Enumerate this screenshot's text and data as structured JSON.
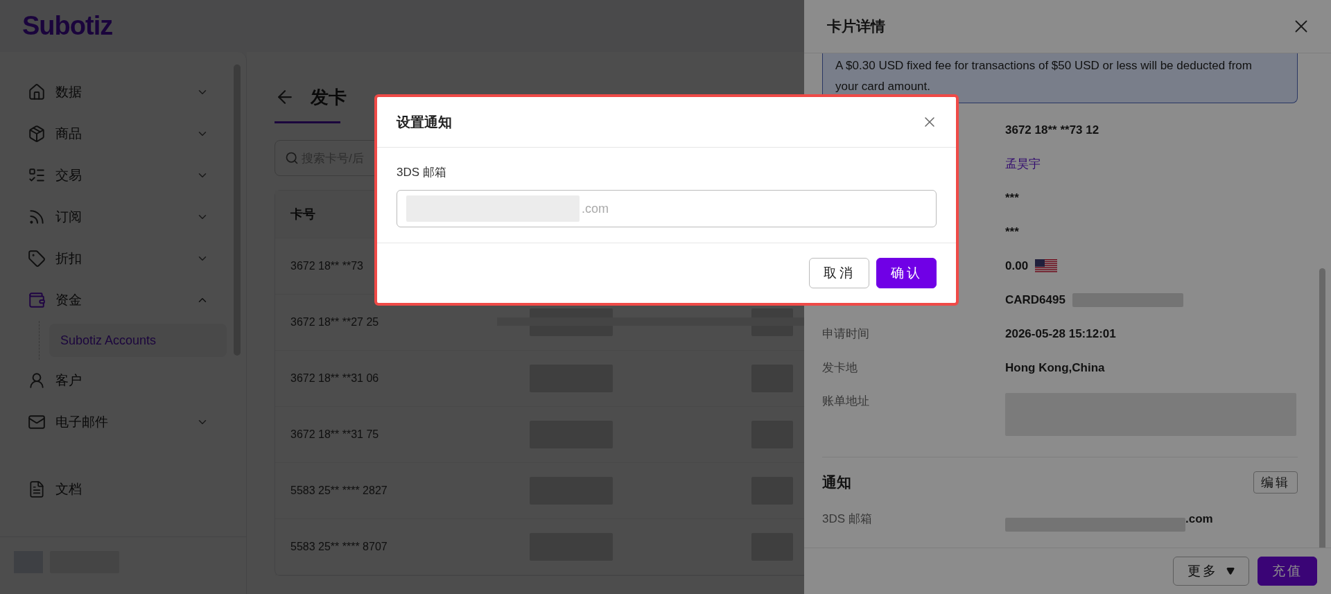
{
  "logo": "Subotiz",
  "sidebar": {
    "items": [
      {
        "label": "数据",
        "kind": "group",
        "expanded": false,
        "selected": false
      },
      {
        "label": "商品",
        "kind": "group",
        "expanded": false,
        "selected": false
      },
      {
        "label": "交易",
        "kind": "group",
        "expanded": false,
        "selected": false
      },
      {
        "label": "订阅",
        "kind": "group",
        "expanded": false,
        "selected": false
      },
      {
        "label": "折扣",
        "kind": "group",
        "expanded": false,
        "selected": false
      },
      {
        "label": "资金",
        "kind": "group",
        "expanded": true,
        "selected": true,
        "children": [
          {
            "label": "Subotiz Accounts",
            "selected": true
          }
        ]
      },
      {
        "label": "客户",
        "kind": "link",
        "selected": false
      },
      {
        "label": "电子邮件",
        "kind": "group",
        "expanded": false,
        "selected": false
      }
    ],
    "footer_item": "文档"
  },
  "page": {
    "title": "发卡",
    "search": {
      "placeholder": "搜索卡号/后"
    },
    "table": {
      "columns": [
        "卡号"
      ],
      "rows": [
        {
          "card": "3672 18** **73"
        },
        {
          "card": "3672 18** **27 25"
        },
        {
          "card": "3672 18** **31 06"
        },
        {
          "card": "3672 18** **31 75"
        },
        {
          "card": "5583 25** **** 2827"
        },
        {
          "card": "5583 25** **** 8707"
        }
      ]
    }
  },
  "drawer": {
    "title": "卡片详情",
    "notice": "A $0.30 USD fixed fee for transactions of $50 USD or less will be deducted from your card amount.",
    "details": [
      {
        "kind": "text",
        "value": "3672 18** **73 12"
      },
      {
        "kind": "link",
        "value": "孟昊宇"
      },
      {
        "kind": "text",
        "value": "***"
      },
      {
        "kind": "text",
        "value": "***"
      },
      {
        "kind": "flag",
        "value": "0.00"
      },
      {
        "kind": "redacted",
        "value": "CARD6495"
      },
      {
        "kind": "text",
        "label": "申请时间",
        "value": "2026-05-28 15:12:01"
      },
      {
        "kind": "text",
        "label": "发卡地",
        "value": "Hong Kong,China"
      },
      {
        "kind": "address",
        "label": "账单地址"
      }
    ],
    "notification": {
      "title": "通知",
      "edit": "编辑",
      "rows": [
        {
          "label": "3DS 邮箱",
          "value": ".com"
        }
      ]
    },
    "footer": {
      "more": "更多",
      "primary": "充值"
    }
  },
  "modal": {
    "title": "设置通知",
    "field_label": "3DS 邮箱",
    "field_value": ".com",
    "cancel": "取消",
    "confirm": "确认"
  }
}
